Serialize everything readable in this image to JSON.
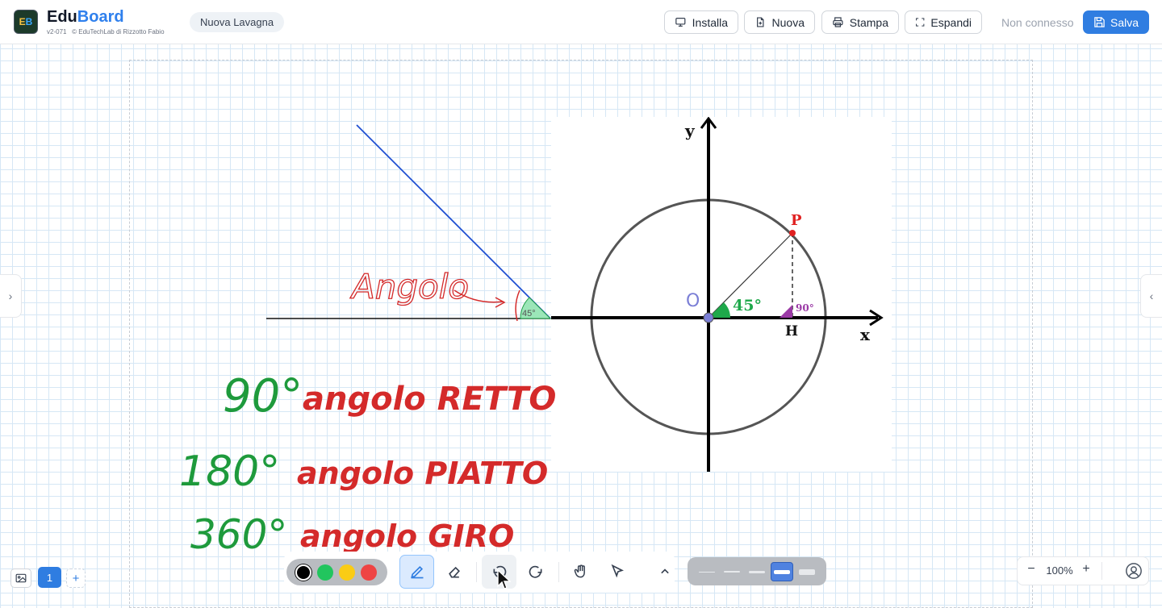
{
  "header": {
    "logo_text_e": "E",
    "logo_text_b": "B",
    "brand_main": "Edu",
    "brand_accent": "Board",
    "version": "v2-071   © EduTechLab di Rizzotto Fabio",
    "board_title": "Nuova Lavagna",
    "buttons": {
      "install": "Installa",
      "new": "Nuova",
      "print": "Stampa",
      "expand": "Espandi"
    },
    "connection_status": "Non connesso",
    "save": "Salva"
  },
  "canvas": {
    "handwriting": {
      "angolo_label": "Angolo",
      "small_angle": "45°",
      "lines": [
        {
          "degrees": "90°",
          "text": "angolo RETTO"
        },
        {
          "degrees": "180°",
          "text": "angolo PIATTO"
        },
        {
          "degrees": "360°",
          "text": "angolo GIRO"
        }
      ]
    },
    "diagram": {
      "y_label": "y",
      "x_label": "x",
      "origin_label": "O",
      "point_label": "P",
      "foot_label": "H",
      "angle_label": "45°",
      "right_angle_label": "90°"
    }
  },
  "pages": {
    "current": "1",
    "add": "+"
  },
  "toolbar": {
    "colors": [
      "#000000",
      "#22c55e",
      "#facc15",
      "#ef4444"
    ],
    "selected_color": "#000000",
    "tools": [
      "pen-icon",
      "eraser-icon",
      "undo-icon",
      "redo-icon",
      "hand-icon",
      "pointer-icon",
      "chevron-up-icon"
    ],
    "active_tool": "pen",
    "stroke_widths_selected": 4
  },
  "zoom": {
    "minus": "−",
    "value": "100%",
    "plus": "+"
  },
  "theme": {
    "accent": "#2f7de1",
    "grid": "#d6e7f5",
    "ink_red": "#d42a2a",
    "ink_green": "#1e9a3c",
    "ink_blue": "#1f4fd1"
  }
}
